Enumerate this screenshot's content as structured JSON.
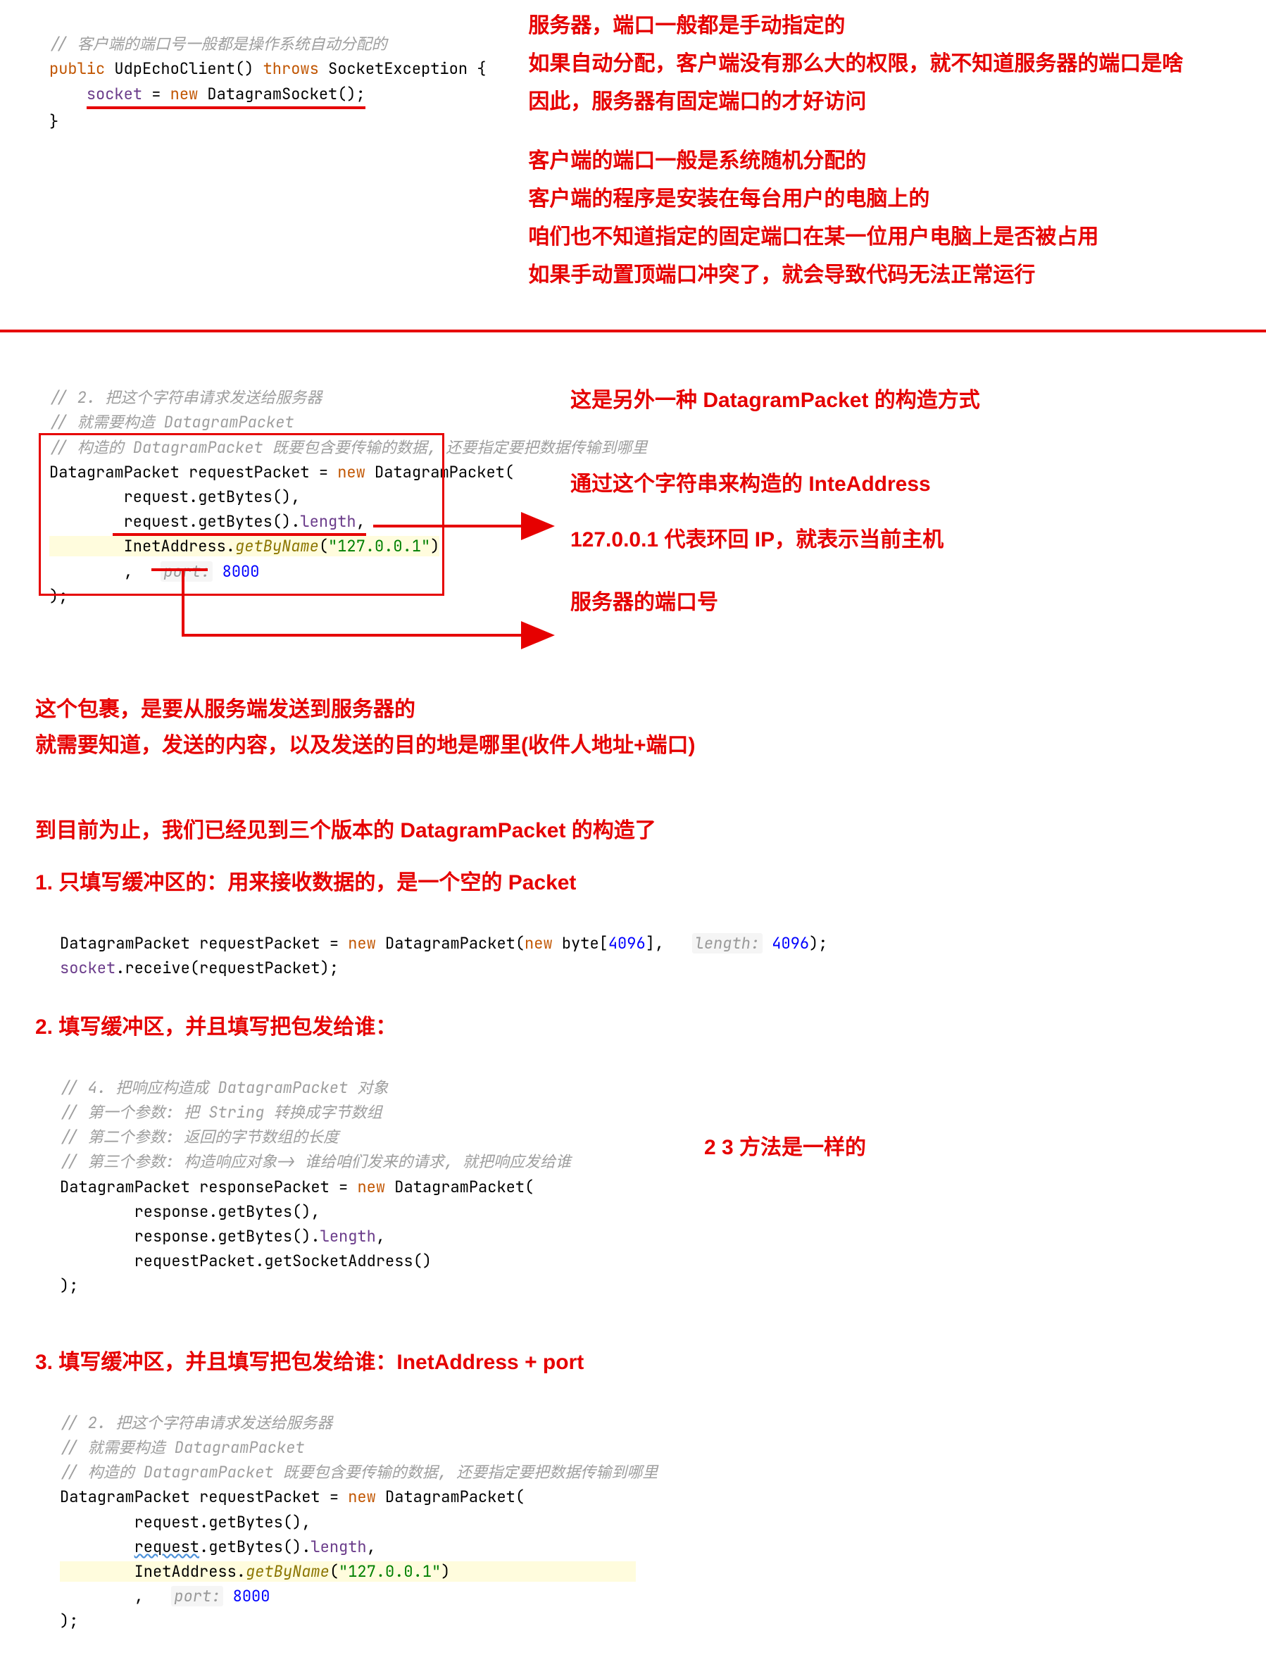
{
  "top": {
    "code": {
      "c1": "// 客户端的端口号一般都是操作系统自动分配的",
      "l2_public": "public",
      "l2_name": " UdpEchoClient() ",
      "l2_throws": "throws",
      "l2_exc": " SocketException {",
      "l3_socket": "socket",
      "l3_eq": " = ",
      "l3_new": "new",
      "l3_ds": " DatagramSocket();",
      "l4": "}"
    },
    "notes": {
      "n1": "服务器，端口一般都是手动指定的",
      "n2": "如果自动分配，客户端没有那么大的权限，就不知道服务器的端口是啥",
      "n3": "因此，服务器有固定端口的才好访问",
      "n4": "客户端的端口一般是系统随机分配的",
      "n5": "客户端的程序是安装在每台用户的电脑上的",
      "n6": "咱们也不知道指定的固定端口在某一位用户电脑上是否被占用",
      "n7": "如果手动置顶端口冲突了，就会导致代码无法正常运行"
    }
  },
  "mid": {
    "code": {
      "c1": "// 2. 把这个字符串请求发送给服务器",
      "c2": "// 就需要构造 DatagramPacket",
      "c3": "// 构造的 DatagramPacket 既要包含要传输的数据, 还要指定要把数据传输到哪里",
      "l4a": "DatagramPacket ",
      "l4b": "requestPacket ",
      "l4c": "= ",
      "l4new": "new",
      "l4d": " DatagramPacket(",
      "l5a": "request",
      "l5b": ".getBytes(),",
      "l6a": "request",
      "l6b": ".getBytes().",
      "l6c": "length",
      "l6d": ",",
      "l7a": "InetAddress.",
      "l7b": "getByName",
      "l7c": "(",
      "l7str": "\"127.0.0.1\"",
      "l7d": ")",
      "l8a": ",   ",
      "l8hint": "port:",
      "l8b": " 8000",
      "l9": ");"
    },
    "notes": {
      "n1": "这是另外一种 DatagramPacket 的构造方式",
      "n2": "通过这个字符串来构造的 InteAddress",
      "n3": "127.0.0.1 代表环回 IP，就表示当前主机",
      "n4": "服务器的端口号"
    },
    "below": {
      "b1": "这个包裹，是要从服务端发送到服务器的",
      "b2": "就需要知道，发送的内容，以及发送的目的地是哪里(收件人地址+端口)"
    }
  },
  "versions": {
    "header": "到目前为止，我们已经见到三个版本的 DatagramPacket 的构造了",
    "v1": {
      "title": "1. 只填写缓冲区的：用来接收数据的，是一个空的 Packet",
      "code": {
        "l1a": "DatagramPacket ",
        "l1b": "requestPacket ",
        "l1c": "= ",
        "l1new": "new",
        "l1d": " DatagramPacket(",
        "l1e": "new",
        "l1f": " byte[",
        "l1g": "4096",
        "l1h": "],   ",
        "l1hint": "length:",
        "l1i": " 4096",
        "l1j": ");",
        "l2a": "socket",
        "l2b": ".receive(",
        "l2c": "requestPacket",
        "l2d": ");"
      }
    },
    "v2": {
      "title": "2. 填写缓冲区，并且填写把包发给谁：",
      "note": "2 3 方法是一样的",
      "code": {
        "c1": "// 4. 把响应构造成 DatagramPacket 对象",
        "c2": "// 第一个参数: 把 String 转换成字节数组",
        "c3": "// 第二个参数: 返回的字节数组的长度",
        "c4": "// 第三个参数: 构造响应对象-> 谁给咱们发来的请求, 就把响应发给谁",
        "l5a": "DatagramPacket ",
        "l5b": "responsePacket ",
        "l5c": "= ",
        "l5new": "new",
        "l5d": " DatagramPacket(",
        "l6a": "response",
        "l6b": ".getBytes(),",
        "l7a": "response",
        "l7b": ".getBytes().",
        "l7c": "length",
        "l7d": ",",
        "l8a": "requestPacket",
        "l8b": ".getSocketAddress()",
        "l9": ");"
      }
    },
    "v3": {
      "title": "3. 填写缓冲区，并且填写把包发给谁：InetAddress + port",
      "code": {
        "c1": "// 2. 把这个字符串请求发送给服务器",
        "c2": "// 就需要构造 DatagramPacket",
        "c3": "// 构造的 DatagramPacket 既要包含要传输的数据, 还要指定要把数据传输到哪里",
        "l4a": "DatagramPacket ",
        "l4b": "requestPacket ",
        "l4c": "= ",
        "l4new": "new",
        "l4d": " DatagramPacket(",
        "l5a": "request",
        "l5b": ".getBytes(),",
        "l6a": "request",
        "l6b": ".getBytes().",
        "l6c": "length",
        "l6d": ",",
        "l7a": "InetAddress.",
        "l7b": "getByName",
        "l7c": "(",
        "l7str": "\"127.0.0.1\"",
        "l7d": ")",
        "l8a": ",   ",
        "l8hint": "port:",
        "l8b": " 8000",
        "l9": ");"
      }
    }
  }
}
